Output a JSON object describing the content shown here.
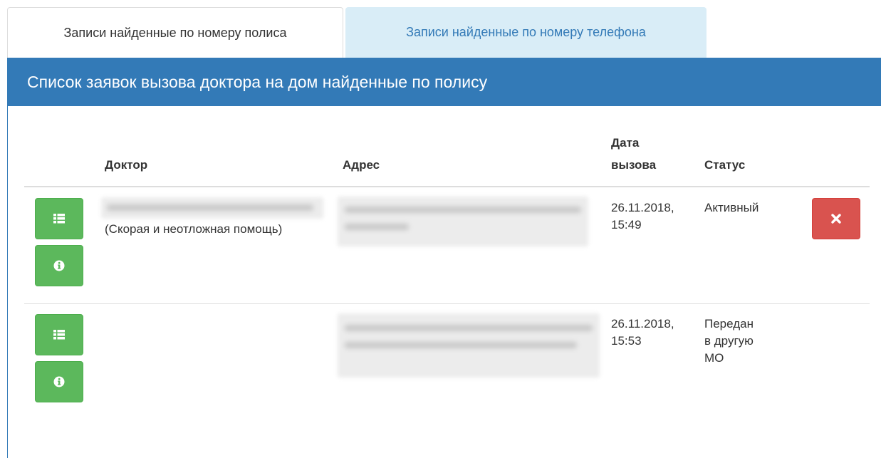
{
  "tabs": [
    {
      "label": "Записи найденные по номеру полиса",
      "active": true
    },
    {
      "label": "Записи найденные по номеру телефона",
      "active": false
    }
  ],
  "panel": {
    "title": "Список заявок вызова доктора на дом найденные по полису"
  },
  "table": {
    "headers": {
      "doctor": "Доктор",
      "address": "Адрес",
      "date_line1": "Дата",
      "date_line2": "вызова",
      "status": "Статус"
    },
    "rows": [
      {
        "doctor_note": "(Скорая и неотложная помощь)",
        "date_line1": "26.11.2018,",
        "date_line2": "15:49",
        "status_lines": [
          "Активный"
        ],
        "has_delete": true
      },
      {
        "doctor_note": "",
        "date_line1": "26.11.2018,",
        "date_line2": "15:53",
        "status_lines": [
          "Передан",
          "в другую",
          "МО"
        ],
        "has_delete": false
      }
    ]
  },
  "icons": {
    "list": "list-icon",
    "info": "info-icon",
    "delete": "close-icon"
  },
  "colors": {
    "primary": "#337ab7",
    "tab_inactive_bg": "#d9edf7",
    "success": "#5cb85c",
    "danger": "#d9534f"
  }
}
